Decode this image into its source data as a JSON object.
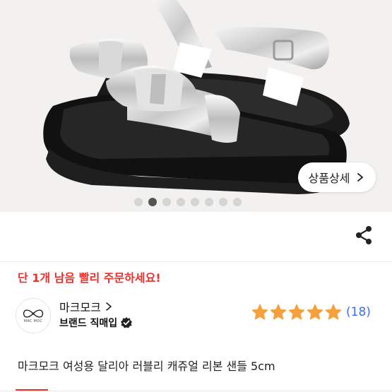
{
  "product": {
    "detail_button_label": "상품상세",
    "urgent_message": "단 1개 남음 빨리 주문하세요!",
    "title": "마크모크 여성용 달리아 러블리 캐쥬얼 리본 샌들 5cm",
    "image_carousel": {
      "total": 8,
      "active_index": 1
    }
  },
  "brand": {
    "name": "마크모크",
    "badge": "브랜드 직매입",
    "logo_text": "MAC MOC"
  },
  "rating": {
    "stars": 5,
    "count": "(18)"
  },
  "colors": {
    "urgent_red": "#e8322c",
    "star_orange": "#f5a03a",
    "link_blue": "#3a6ff2",
    "active_dot": "#555555"
  },
  "icons": {
    "share": "share-icon",
    "chevron": "chevron-right-icon",
    "verified": "verified-check-icon",
    "star": "star-icon"
  }
}
